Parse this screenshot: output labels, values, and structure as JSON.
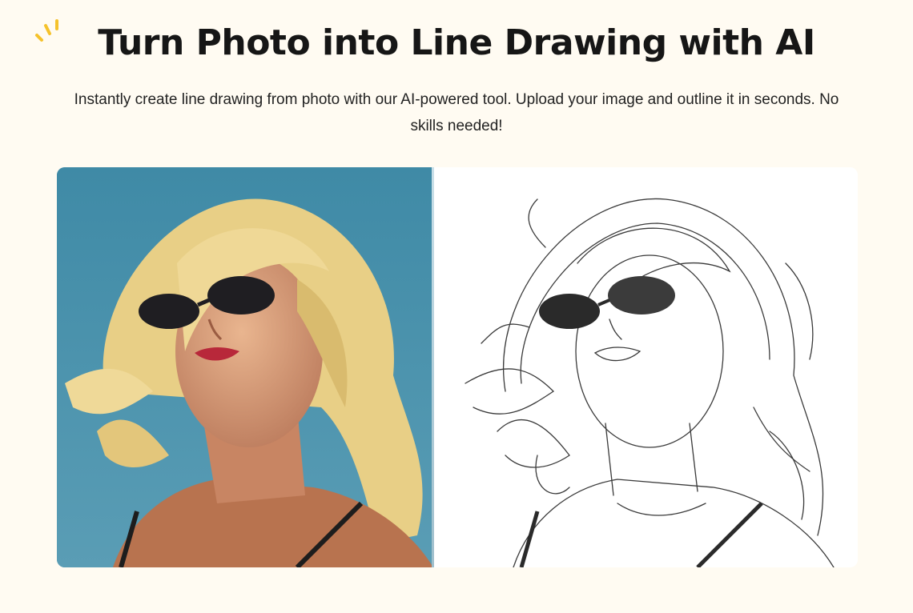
{
  "hero": {
    "title": "Turn Photo into Line Drawing with AI",
    "subtitle": "Instantly create line drawing from photo with our AI-powered tool. Upload your image and outline it in seconds. No skills needed!"
  },
  "comparison": {
    "before_image": "photo-portrait-icon",
    "after_image": "line-drawing-icon"
  },
  "colors": {
    "background": "#fffbf2",
    "accent": "#f5c22b",
    "title": "#161616"
  }
}
